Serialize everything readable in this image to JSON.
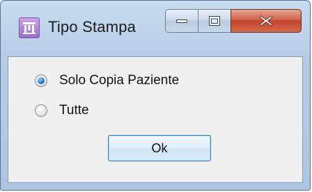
{
  "window": {
    "title": "Tipo Stampa",
    "icon": "app-icon",
    "caption_buttons": {
      "minimize": "minimize-icon",
      "maximize": "maximize-icon",
      "close": "close-icon"
    }
  },
  "options": [
    {
      "label": "Solo Copia Paziente",
      "checked": true
    },
    {
      "label": "Tutte",
      "checked": false
    }
  ],
  "ok_button": {
    "label": "Ok"
  },
  "colors": {
    "frame": "#b7cde6",
    "client_bg": "#f0f0f0",
    "close_button": "#c1432b",
    "radio_selected": "#2a7fd1",
    "ok_border": "#3c7fb1"
  }
}
